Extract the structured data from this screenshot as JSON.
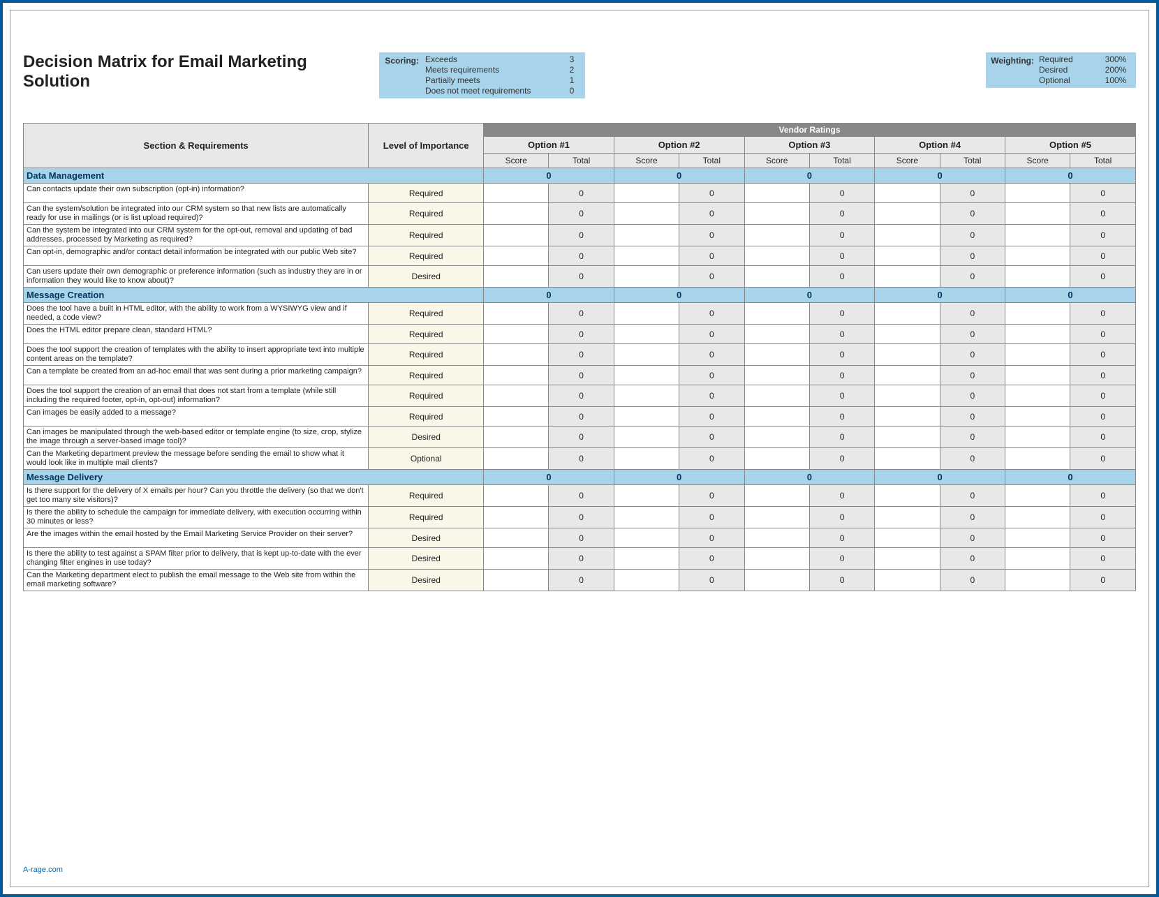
{
  "title": "Decision Matrix for Email Marketing Solution",
  "scoring": {
    "label": "Scoring:",
    "rows": [
      {
        "desc": "Exceeds",
        "val": "3"
      },
      {
        "desc": "Meets requirements",
        "val": "2"
      },
      {
        "desc": "Partially meets",
        "val": "1"
      },
      {
        "desc": "Does not meet requirements",
        "val": "0"
      }
    ]
  },
  "weighting": {
    "label": "Weighting:",
    "rows": [
      {
        "desc": "Required",
        "val": "300%"
      },
      {
        "desc": "Desired",
        "val": "200%"
      },
      {
        "desc": "Optional",
        "val": "100%"
      }
    ]
  },
  "headers": {
    "vendor_ratings": "Vendor Ratings",
    "section_req": "Section & Requirements",
    "importance": "Level of Importance",
    "options": [
      "Option #1",
      "Option #2",
      "Option #3",
      "Option #4",
      "Option #5"
    ],
    "score": "Score",
    "total": "Total"
  },
  "sections": [
    {
      "name": "Data Management",
      "totals": [
        "0",
        "0",
        "0",
        "0",
        "0"
      ],
      "rows": [
        {
          "req": "Can contacts update their own subscription (opt-in) information?",
          "imp": "Required",
          "totals": [
            "0",
            "0",
            "0",
            "0",
            "0"
          ]
        },
        {
          "req": "Can the system/solution be integrated into our CRM system so that new lists are automatically ready for use in mailings (or is list upload required)?",
          "imp": "Required",
          "totals": [
            "0",
            "0",
            "0",
            "0",
            "0"
          ]
        },
        {
          "req": "Can the system be integrated into our CRM system for the opt-out, removal and updating of bad addresses, processed by Marketing as required?",
          "imp": "Required",
          "totals": [
            "0",
            "0",
            "0",
            "0",
            "0"
          ]
        },
        {
          "req": "Can opt-in, demographic and/or contact detail information be integrated with our public Web site?",
          "imp": "Required",
          "totals": [
            "0",
            "0",
            "0",
            "0",
            "0"
          ]
        },
        {
          "req": "Can users update their own demographic or preference information (such as industry they are in or information they would like to know about)?",
          "imp": "Desired",
          "totals": [
            "0",
            "0",
            "0",
            "0",
            "0"
          ]
        }
      ]
    },
    {
      "name": "Message Creation",
      "totals": [
        "0",
        "0",
        "0",
        "0",
        "0"
      ],
      "rows": [
        {
          "req": "Does the tool have a built in HTML editor, with the ability to work from a WYSIWYG view and if needed, a code view?",
          "imp": "Required",
          "totals": [
            "0",
            "0",
            "0",
            "0",
            "0"
          ]
        },
        {
          "req": "Does the HTML editor prepare clean, standard HTML?",
          "imp": "Required",
          "totals": [
            "0",
            "0",
            "0",
            "0",
            "0"
          ]
        },
        {
          "req": "Does the tool support the creation of templates with the ability to insert appropriate text into multiple content areas on the template?",
          "imp": "Required",
          "totals": [
            "0",
            "0",
            "0",
            "0",
            "0"
          ]
        },
        {
          "req": "Can a template be created from an ad-hoc email that was sent during a prior marketing campaign?",
          "imp": "Required",
          "totals": [
            "0",
            "0",
            "0",
            "0",
            "0"
          ]
        },
        {
          "req": "Does the tool support the creation of an email that does not start from a template (while still including the required footer, opt-in, opt-out) information?",
          "imp": "Required",
          "totals": [
            "0",
            "0",
            "0",
            "0",
            "0"
          ]
        },
        {
          "req": "Can images be easily added to a message?",
          "imp": "Required",
          "totals": [
            "0",
            "0",
            "0",
            "0",
            "0"
          ]
        },
        {
          "req": "Can images be manipulated through the web-based editor or template engine (to size, crop, stylize the image through a server-based image tool)?",
          "imp": "Desired",
          "totals": [
            "0",
            "0",
            "0",
            "0",
            "0"
          ]
        },
        {
          "req": "Can the Marketing department preview the message before sending the email to show what it would look like in multiple mail clients?",
          "imp": "Optional",
          "totals": [
            "0",
            "0",
            "0",
            "0",
            "0"
          ]
        }
      ]
    },
    {
      "name": "Message Delivery",
      "totals": [
        "0",
        "0",
        "0",
        "0",
        "0"
      ],
      "rows": [
        {
          "req": "Is there support for the delivery of X emails per hour?  Can you throttle the delivery (so that we don't get too many site visitors)?",
          "imp": "Required",
          "totals": [
            "0",
            "0",
            "0",
            "0",
            "0"
          ]
        },
        {
          "req": "Is there the ability to schedule the campaign for immediate delivery, with execution occurring within 30 minutes or less?",
          "imp": "Required",
          "totals": [
            "0",
            "0",
            "0",
            "0",
            "0"
          ]
        },
        {
          "req": "Are the images within the email hosted by the Email Marketing Service Provider on their server?",
          "imp": "Desired",
          "totals": [
            "0",
            "0",
            "0",
            "0",
            "0"
          ]
        },
        {
          "req": "Is there the ability to test against a SPAM filter prior to delivery, that is kept up-to-date with the ever changing filter engines in use today?",
          "imp": "Desired",
          "totals": [
            "0",
            "0",
            "0",
            "0",
            "0"
          ]
        },
        {
          "req": "Can the Marketing department elect to publish the email message to the Web site from within the email marketing software?",
          "imp": "Desired",
          "totals": [
            "0",
            "0",
            "0",
            "0",
            "0"
          ]
        }
      ]
    }
  ],
  "footer": "A-rage.com"
}
